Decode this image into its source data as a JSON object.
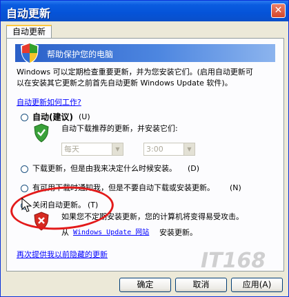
{
  "window": {
    "title": "自动更新",
    "close_glyph": "✕"
  },
  "tab": {
    "label": "自动更新"
  },
  "banner": {
    "text": "帮助保护您的电脑"
  },
  "intro": {
    "line1": "Windows 可以定期检查重要更新，并为您安装它们。(启用自动更新可",
    "line2": "以在安装其它更新之前首先自动更新 Windows Update 软件)。"
  },
  "how_link": "自动更新如何工作?",
  "options": {
    "auto": {
      "label": "自动(建议)",
      "hotkey": "(U)",
      "desc": "自动下载推荐的更新，并安装它们:"
    },
    "download": {
      "label": "下载更新，但是由我来决定什么时候安装。",
      "hotkey": "(D)"
    },
    "notify": {
      "label": "有可用下载时通知我，但是不要自动下载或安装更新。",
      "hotkey": "(N)"
    },
    "off": {
      "label": "关闭自动更新。",
      "hotkey": "(T)"
    }
  },
  "schedule": {
    "day": "每天",
    "time": "3:00"
  },
  "off_warning": {
    "line1": "如果您不定期安装更新，您的计算机将变得易受攻击。",
    "prefix": "从",
    "link": "Windows Update 网站",
    "suffix": "安装更新。"
  },
  "reoffer_link": "再次提供我以前隐藏的更新",
  "buttons": {
    "ok": "确定",
    "cancel": "取消",
    "apply": "应用(A)"
  },
  "watermark": "IT168",
  "colors": {
    "title_blue": "#0553d8",
    "link_blue": "#0000ff",
    "annotation_red": "#e31a1a"
  }
}
